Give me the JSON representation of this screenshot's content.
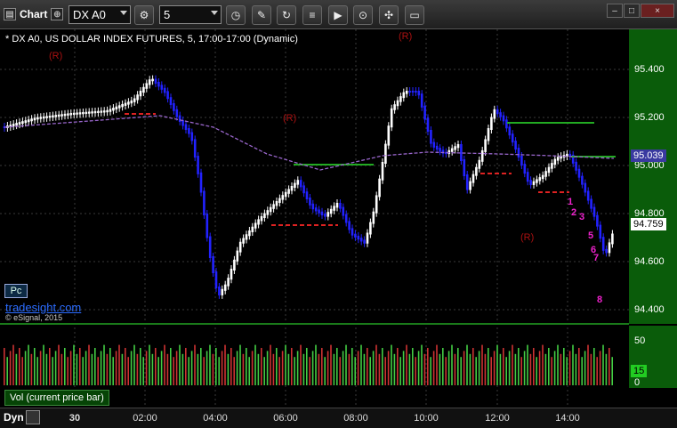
{
  "toolbar": {
    "title": "Chart",
    "symbol": "DX A0",
    "interval": "5",
    "window_buttons": [
      "–",
      "□",
      "×"
    ]
  },
  "chart": {
    "header": "* DX A0, US DOLLAR INDEX FUTURES, 5, 17:00-17:00 (Dynamic)",
    "pc_badge": "Pc",
    "watermark": "tradesight.com",
    "copyright": "© eSignal, 2015",
    "price_labels": [
      "95.400",
      "95.200",
      "95.000",
      "94.800",
      "94.600",
      "94.400"
    ],
    "ma_tag": {
      "text": "95.039",
      "color": "#3a3aa0"
    },
    "last_tag": {
      "text": "94.759",
      "color": "#ffffff"
    },
    "r_markers": [
      "(R)",
      "(R)",
      "(R)",
      "(R)"
    ],
    "count_labels": [
      "1",
      "2",
      "3",
      "5",
      "6",
      "7",
      "8"
    ],
    "colors": {
      "up": "#ffffff",
      "down": "#2222ff",
      "ma": "#9966cc",
      "red_line": "#dd2222",
      "green_line": "#22aa22",
      "count": "#ee22cc"
    }
  },
  "volume": {
    "label": "Vol (current price bar)",
    "axis_labels": [
      "50",
      "0"
    ],
    "last_tag": "15"
  },
  "time_axis": {
    "dyn": "Dyn",
    "labels": [
      "30",
      "02:00",
      "04:00",
      "06:00",
      "08:00",
      "10:00",
      "12:00",
      "14:00"
    ]
  }
}
